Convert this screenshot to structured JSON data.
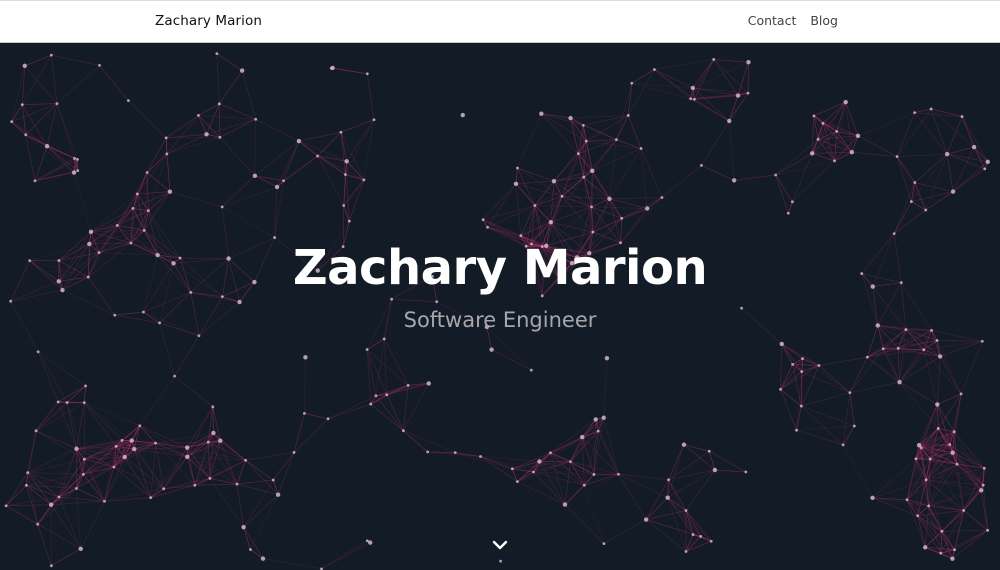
{
  "nav": {
    "brand": "Zachary Marion",
    "links": [
      "Contact",
      "Blog"
    ]
  },
  "hero": {
    "title": "Zachary Marion",
    "subtitle": "Software Engineer",
    "scroll_icon": "chevron-down-icon"
  },
  "colors": {
    "background": "#131c26",
    "network_line": "#c0306f",
    "network_node": "#d9c2d6",
    "navbar": "#ffffff"
  }
}
